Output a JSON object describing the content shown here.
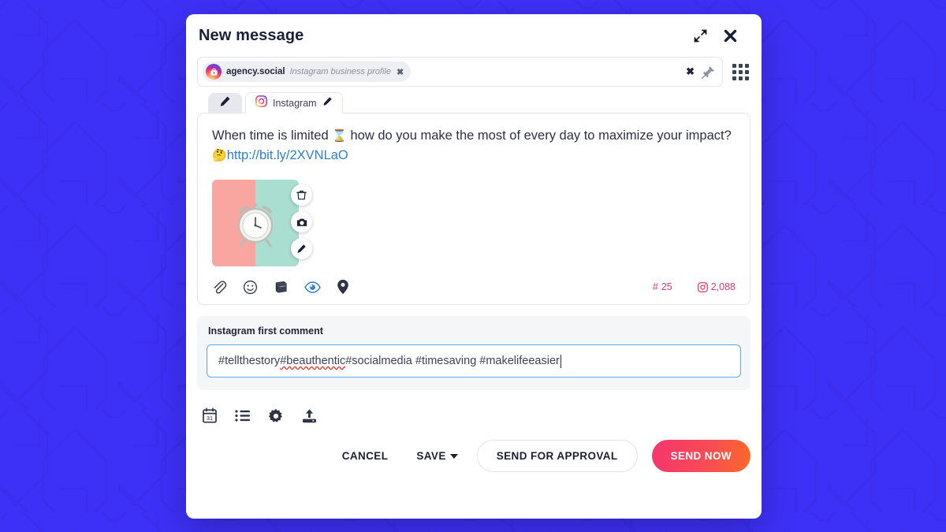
{
  "background": {
    "color": "#3e31f7",
    "pattern": "geometric-maze-lines"
  },
  "modal": {
    "title": "New message",
    "header_actions": [
      {
        "name": "expand-icon",
        "label": "Expand"
      },
      {
        "name": "close-icon",
        "label": "Close"
      }
    ]
  },
  "recipient": {
    "chip": {
      "name": "agency.social",
      "type": "Instagram business profile",
      "remove_label": "✖",
      "avatar": "instagram-business-avatar"
    },
    "clear_label": "✖",
    "pin_icon": "pushpin-icon",
    "grid_icon": "grid-apps-icon"
  },
  "tabs": [
    {
      "label": "",
      "icon": "pencil-icon",
      "active": false,
      "name": "tab-compose"
    },
    {
      "label": "Instagram",
      "icon": "instagram-icon",
      "edit_icon": "pencil-icon",
      "active": true,
      "name": "tab-instagram"
    }
  ],
  "composer": {
    "text_before": "When time is limited ",
    "emoji_hourglass": "⌛",
    "text_middle": " how do you make the most of every day to maximize your impact? ",
    "emoji_thinking": "🤔",
    "link": "http://bit.ly/2XVNLaO",
    "link_color": "#2e80cf",
    "media": {
      "alt": "alarm clock on pink and mint background",
      "actions": [
        {
          "name": "delete-media-button",
          "icon": "trash-icon"
        },
        {
          "name": "camera-media-button",
          "icon": "camera-icon"
        },
        {
          "name": "edit-media-button",
          "icon": "pencil-icon"
        }
      ]
    },
    "toolbar": [
      {
        "name": "attach-file-icon",
        "icon": "paperclip-icon"
      },
      {
        "name": "emoji-picker-icon",
        "icon": "smiley-icon"
      },
      {
        "name": "content-library-icon",
        "icon": "book-icon"
      },
      {
        "name": "preview-icon",
        "icon": "eye-icon",
        "active": true
      },
      {
        "name": "location-icon",
        "icon": "map-pin-icon"
      }
    ],
    "counters": {
      "hashtag_symbol": "#",
      "hashtag_count": "25",
      "char_icon": "instagram-icon",
      "char_count": "2,088",
      "color": "#e03a6d"
    }
  },
  "first_comment": {
    "label": "Instagram first comment",
    "value_parts": [
      {
        "text": "#tellthestory ",
        "spellerror": false
      },
      {
        "text": "#beauthentic",
        "spellerror": true
      },
      {
        "text": " #socialmedia #timesaving #makelifeeasier",
        "spellerror": false
      }
    ],
    "full_value": "#tellthestory #beauthentic #socialmedia #timesaving #makelifeeasier",
    "focused": true
  },
  "footer": {
    "icons": [
      {
        "name": "schedule-calendar-icon",
        "icon": "calendar-31-icon"
      },
      {
        "name": "queue-list-icon",
        "icon": "list-icon"
      },
      {
        "name": "settings-gear-icon",
        "icon": "gear-icon"
      },
      {
        "name": "upload-icon",
        "icon": "upload-icon"
      }
    ],
    "cancel_label": "CANCEL",
    "save_label": "SAVE",
    "send_for_approval_label": "SEND FOR APPROVAL",
    "send_now_label": "SEND NOW",
    "send_now_gradient": [
      "#f6356e",
      "#fa6a28"
    ]
  }
}
